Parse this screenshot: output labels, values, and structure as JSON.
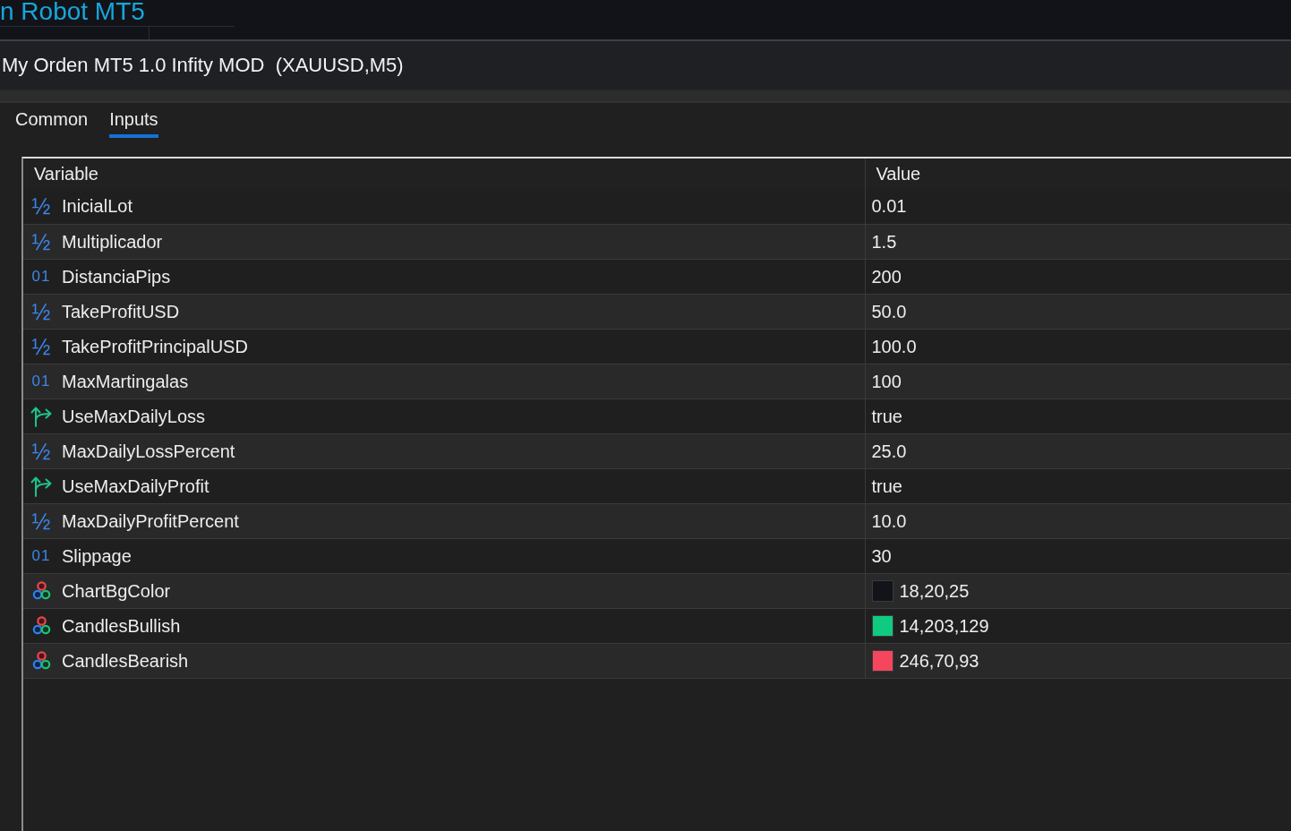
{
  "background": {
    "chart_text": "n Robot MT5"
  },
  "dialog": {
    "title": "My Orden MT5 1.0 Infity MOD  (XAUUSD,M5)",
    "tabs": [
      {
        "label": "Common",
        "selected": false
      },
      {
        "label": "Inputs",
        "selected": true
      }
    ],
    "table": {
      "columns": [
        "Variable",
        "Value"
      ],
      "rows": [
        {
          "kind": "double",
          "type_glyph": "½",
          "variable": "InicialLot",
          "value": "0.01"
        },
        {
          "kind": "double",
          "type_glyph": "½",
          "variable": "Multiplicador",
          "value": "1.5"
        },
        {
          "kind": "int",
          "type_glyph": "01",
          "variable": "DistanciaPips",
          "value": "200"
        },
        {
          "kind": "double",
          "type_glyph": "½",
          "variable": "TakeProfitUSD",
          "value": "50.0"
        },
        {
          "kind": "double",
          "type_glyph": "½",
          "variable": "TakeProfitPrincipalUSD",
          "value": "100.0"
        },
        {
          "kind": "int",
          "type_glyph": "01",
          "variable": "MaxMartingalas",
          "value": "100"
        },
        {
          "kind": "bool",
          "variable": "UseMaxDailyLoss",
          "value": "true"
        },
        {
          "kind": "double",
          "type_glyph": "½",
          "variable": "MaxDailyLossPercent",
          "value": "25.0"
        },
        {
          "kind": "bool",
          "variable": "UseMaxDailyProfit",
          "value": "true"
        },
        {
          "kind": "double",
          "type_glyph": "½",
          "variable": "MaxDailyProfitPercent",
          "value": "10.0"
        },
        {
          "kind": "int",
          "type_glyph": "01",
          "variable": "Slippage",
          "value": "30"
        },
        {
          "kind": "color",
          "variable": "ChartBgColor",
          "value": "18,20,25",
          "color": "#121419"
        },
        {
          "kind": "color",
          "variable": "CandlesBullish",
          "value": "14,203,129",
          "color": "#0ecb81"
        },
        {
          "kind": "color",
          "variable": "CandlesBearish",
          "value": "246,70,93",
          "color": "#f6465d"
        }
      ]
    }
  }
}
